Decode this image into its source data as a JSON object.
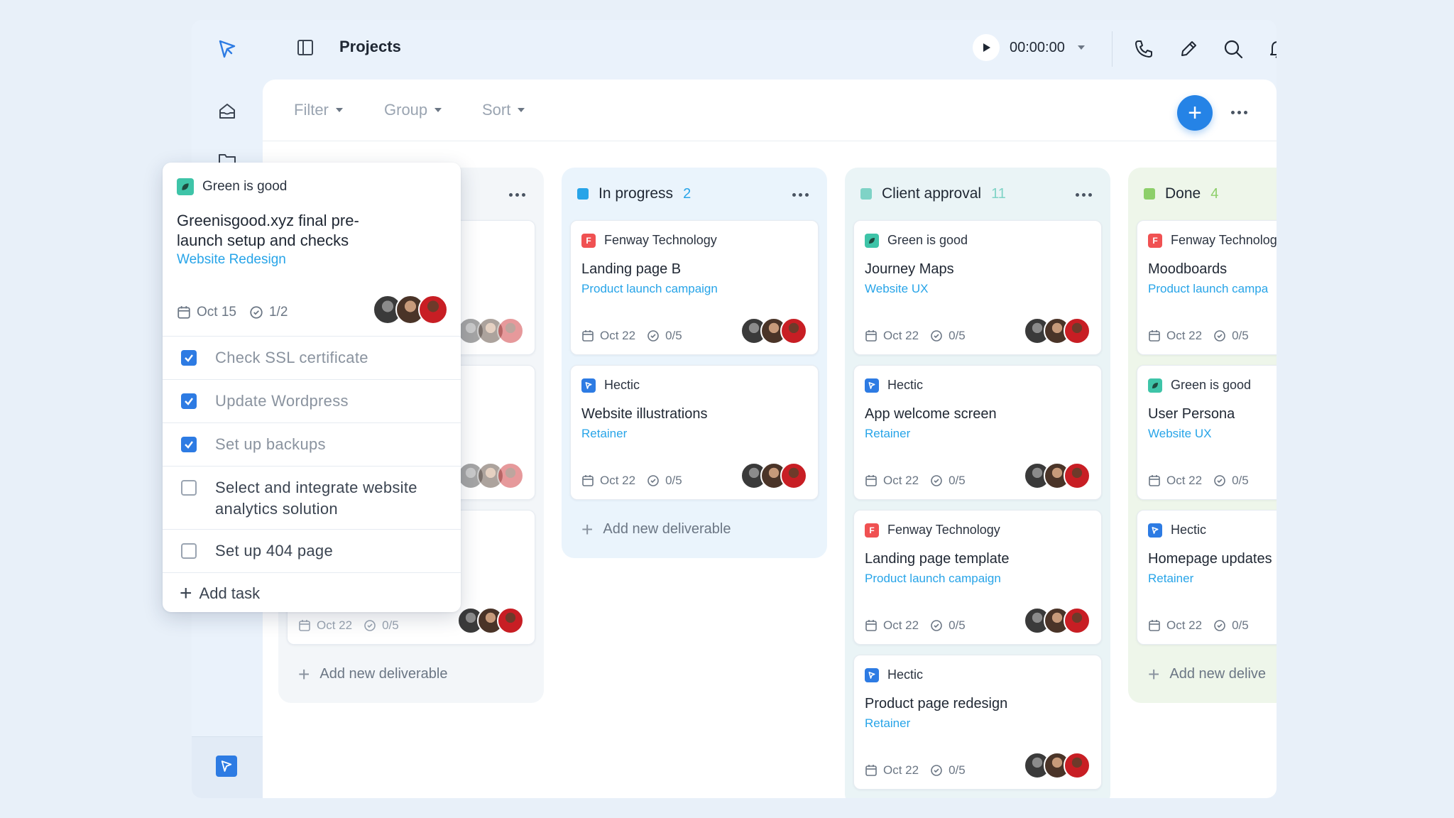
{
  "topbar": {
    "title": "Projects",
    "timer": "00:00:00"
  },
  "toolbar": {
    "filter": "Filter",
    "group": "Group",
    "sort": "Sort"
  },
  "colors": {
    "accent": "#2583e6",
    "link": "#27a4e8",
    "in_progress": "#27a4e8",
    "client_approval": "#7fd3c6",
    "done": "#8dcf6a"
  },
  "columns": [
    {
      "title": "In progress",
      "count": "2",
      "cards": [
        {
          "client": "Fenway Technology",
          "logo": "F",
          "title": "Landing page B",
          "project": "Product launch campaign",
          "date": "Oct 22",
          "tasks": "0/5"
        },
        {
          "client": "Hectic",
          "logo": "H",
          "title": "Website illustrations",
          "project": "Retainer",
          "date": "Oct 22",
          "tasks": "0/5"
        }
      ],
      "add_label": "Add new deliverable"
    },
    {
      "title": "Client approval",
      "count": "11",
      "cards": [
        {
          "client": "Green is good",
          "logo": "G",
          "title": "Journey Maps",
          "project": "Website UX",
          "date": "Oct 22",
          "tasks": "0/5"
        },
        {
          "client": "Hectic",
          "logo": "H",
          "title": "App welcome screen",
          "project": "Retainer",
          "date": "Oct 22",
          "tasks": "0/5"
        },
        {
          "client": "Fenway Technology",
          "logo": "F",
          "title": "Landing page template",
          "project": "Product launch campaign",
          "date": "Oct 22",
          "tasks": "0/5"
        },
        {
          "client": "Hectic",
          "logo": "H",
          "title": "Product page redesign",
          "project": "Retainer",
          "date": "Oct 22",
          "tasks": "0/5"
        }
      ]
    },
    {
      "title": "Done",
      "count": "4",
      "cards": [
        {
          "client": "Fenway Technolog",
          "logo": "F",
          "title": "Moodboards",
          "project": "Product launch campa",
          "date": "Oct 22",
          "tasks": "0/5"
        },
        {
          "client": "Green is good",
          "logo": "G",
          "title": "User Persona",
          "project": "Website UX",
          "date": "Oct 22",
          "tasks": "0/5"
        },
        {
          "client": "Hectic",
          "logo": "H",
          "title": "Homepage updates",
          "project": "Retainer",
          "date": "Oct 22",
          "tasks": "0/5"
        }
      ],
      "add_label": "Add new delive"
    }
  ],
  "first_column": {
    "card3_date": "Oct 22",
    "card3_tasks": "0/5",
    "add_label": "Add new deliverable"
  },
  "popup": {
    "client": "Green is good",
    "title": "Greenisgood.xyz final pre-launch setup and checks",
    "project": "Website Redesign",
    "date": "Oct 15",
    "progress": "1/2",
    "tasks": [
      {
        "label": "Check SSL certificate",
        "checked": true
      },
      {
        "label": "Update Wordpress",
        "checked": true
      },
      {
        "label": "Set up backups",
        "checked": true
      },
      {
        "label": "Select and integrate website analytics solution",
        "checked": false
      },
      {
        "label": "Set up 404 page",
        "checked": false
      }
    ],
    "add_task": "Add task"
  }
}
